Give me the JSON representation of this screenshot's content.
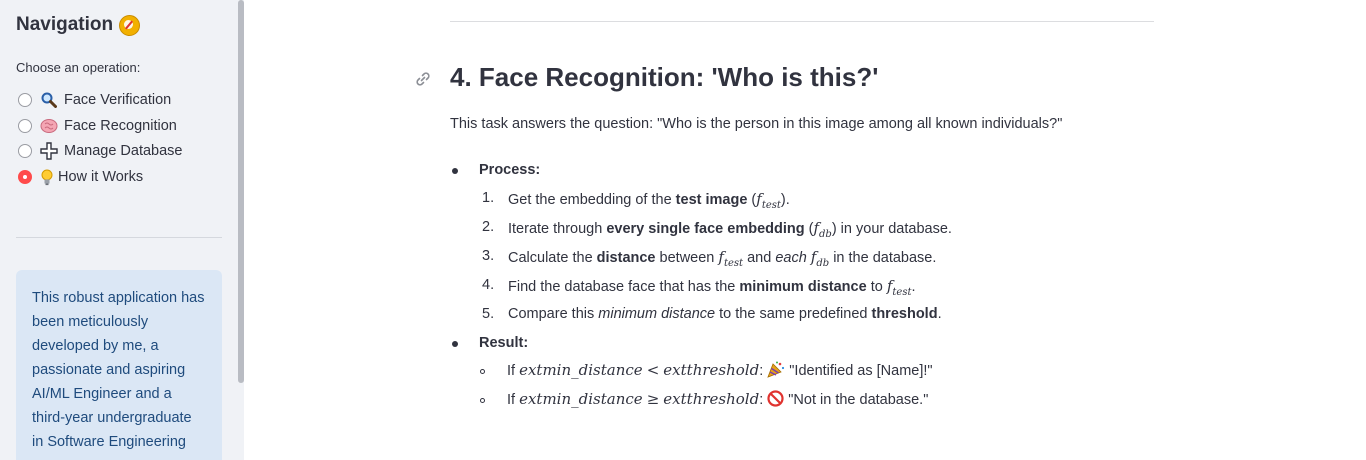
{
  "sidebar": {
    "title": "Navigation",
    "title_icon": "compass-icon",
    "choose_label": "Choose an operation:",
    "options": [
      {
        "label": "Face Verification",
        "icon": "magnifier-icon",
        "selected": false
      },
      {
        "label": "Face Recognition",
        "icon": "brain-icon",
        "selected": false
      },
      {
        "label": "Manage Database",
        "icon": "plus-icon",
        "selected": false
      },
      {
        "label": "How it Works",
        "icon": "lightbulb-icon",
        "selected": true
      }
    ],
    "info_text": "This robust application has been meticulously developed by me, a passionate and aspiring AI/ML Engineer and a third-year undergraduate in Software Engineering"
  },
  "main": {
    "heading": "4. Face Recognition: 'Who is this?'",
    "intro": "This task answers the question: \"Who is the person in this image among all known individuals?\"",
    "process_label": "Process:",
    "steps": [
      {
        "n": "1.",
        "a": "Get the embedding of the ",
        "b": "test image",
        "c": " (",
        "m": "f",
        "msub": "test",
        "d": ")."
      },
      {
        "n": "2.",
        "a": "Iterate through ",
        "b": "every single face embedding",
        "c": " (",
        "m": "f",
        "msub": "db",
        "d": ") in your database."
      },
      {
        "n": "3.",
        "a": "Calculate the ",
        "b": "distance",
        "c": " between ",
        "m": "f",
        "msub": "test",
        "e1": " and ",
        "em": "each",
        "m2": "f",
        "m2sub": "db",
        "d": " in the database."
      },
      {
        "n": "4.",
        "a": "Find the database face that has the ",
        "b": "minimum distance",
        "c": " to ",
        "m": "f",
        "msub": "test",
        "d": "."
      },
      {
        "n": "5.",
        "a": "Compare this ",
        "em": "minimum distance",
        "c": " to the same predefined ",
        "b": "threshold",
        "d": "."
      }
    ],
    "result_label": "Result:",
    "results": [
      {
        "pre": "If ",
        "expr1": "extmin_distance",
        "op": "<",
        "expr2": "extthreshold",
        "colon": ":",
        "icon": "party-popper-icon",
        "text": "\"Identified as [Name]!\""
      },
      {
        "pre": "If ",
        "expr1": "extmin_distance",
        "op": "≥",
        "expr2": "extthreshold",
        "colon": ":",
        "icon": "prohibited-icon",
        "text": "\"Not in the database.\""
      }
    ]
  }
}
